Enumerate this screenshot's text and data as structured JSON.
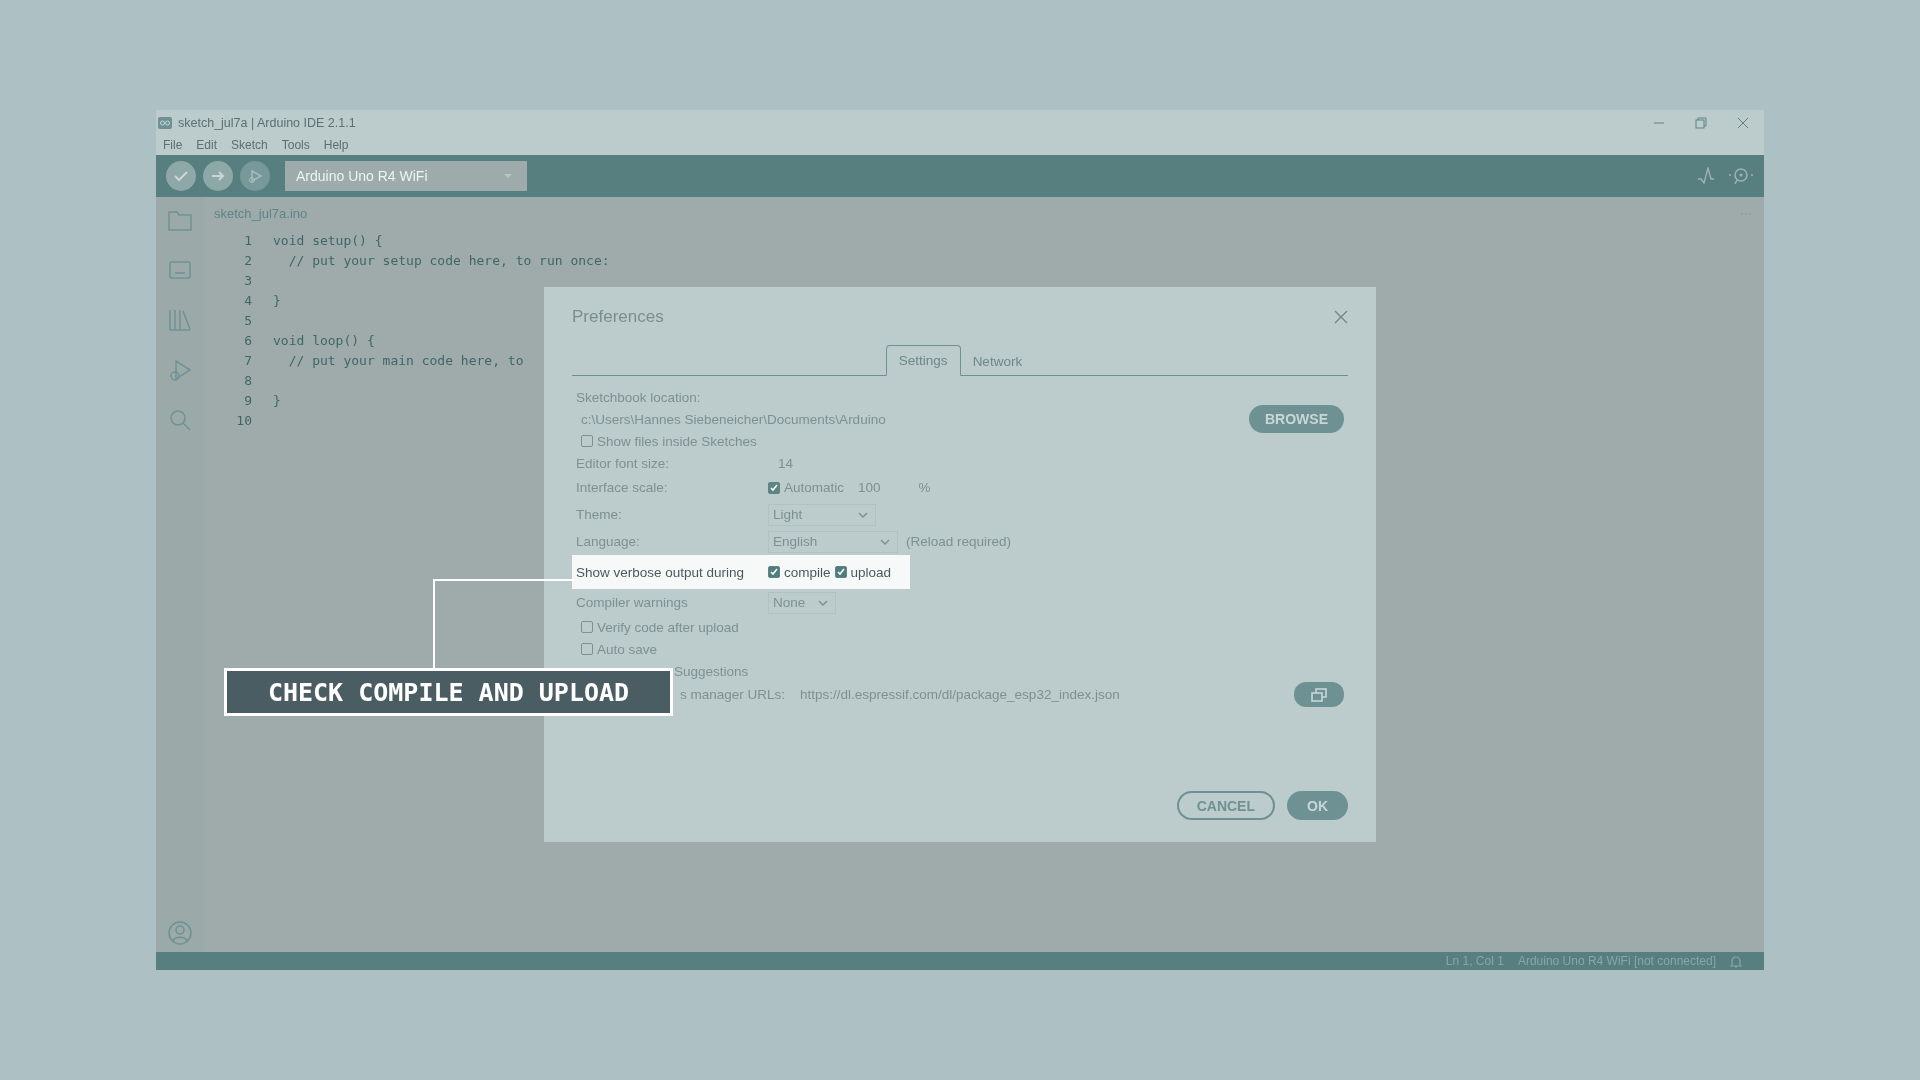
{
  "window": {
    "title": "sketch_jul7a | Arduino IDE 2.1.1"
  },
  "menu": [
    "File",
    "Edit",
    "Sketch",
    "Tools",
    "Help"
  ],
  "toolbar": {
    "board": "Arduino Uno R4 WiFi"
  },
  "editor": {
    "tab": "sketch_jul7a.ino",
    "lines": [
      {
        "number": "1",
        "code": "void setup() {"
      },
      {
        "number": "2",
        "code": "  // put your setup code here, to run once:"
      },
      {
        "number": "3"
      },
      {
        "number": "4",
        "code": "}"
      },
      {
        "number": "5"
      },
      {
        "number": "6",
        "code": "void loop() {"
      },
      {
        "number": "7",
        "code": "  // put your main code here, to"
      },
      {
        "number": "8"
      },
      {
        "number": "9",
        "code": "}"
      },
      {
        "number": "10"
      }
    ]
  },
  "dialog": {
    "title": "Preferences",
    "tabs": [
      {
        "label": "Settings",
        "selected": true
      },
      {
        "label": "Network",
        "selected": false
      }
    ],
    "rows": [
      {
        "kind": "label",
        "label": "Sketchbook location:"
      },
      {
        "kind": "path",
        "value": "c:\\Users\\Hannes Siebeneicher\\Documents\\Arduino",
        "button": "BROWSE"
      },
      {
        "kind": "checkbox",
        "label": "Show files inside Sketches",
        "checked": false
      },
      {
        "kind": "text",
        "label": "Editor font size:",
        "value": "14"
      },
      {
        "kind": "scale",
        "label": "Interface scale:",
        "option": "Automatic",
        "checked": true,
        "value": "100",
        "unit": "%"
      },
      {
        "kind": "select",
        "label": "Theme:",
        "value": "Light"
      },
      {
        "kind": "select",
        "label": "Language:",
        "value": "English",
        "note": "(Reload required)"
      },
      {
        "kind": "checks",
        "label": "Show verbose output during",
        "highlighted": true,
        "options": [
          {
            "label": "compile",
            "checked": true
          },
          {
            "label": "upload",
            "checked": true
          }
        ]
      },
      {
        "kind": "select",
        "label": "Compiler warnings",
        "value": "None"
      },
      {
        "kind": "checkbox",
        "label": "Verify code after upload",
        "checked": false
      },
      {
        "kind": "checkbox",
        "label": "Auto save",
        "checked": false
      },
      {
        "kind": "partial",
        "label": "Suggestions"
      },
      {
        "kind": "url",
        "label": "s manager URLs:",
        "value": "https://dl.espressif.com/dl/package_esp32_index.json"
      }
    ],
    "buttons": [
      {
        "label": "CANCEL",
        "kind": "outline"
      },
      {
        "label": "OK",
        "kind": "primary"
      }
    ]
  },
  "callout": {
    "text": "CHECK COMPILE AND UPLOAD"
  },
  "status_bar": {
    "position": "Ln 1, Col 1",
    "board": "Arduino Uno R4 WiFi [not connected]"
  }
}
